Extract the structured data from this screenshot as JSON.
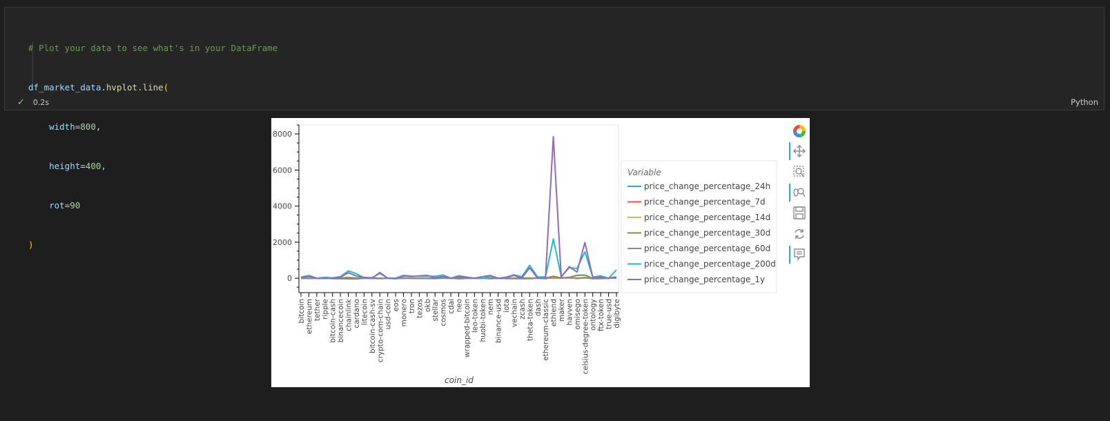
{
  "cell": {
    "code_lines": [
      {
        "type": "comment",
        "text": "# Plot your data to see what's in your DataFrame"
      },
      {
        "type": "call",
        "var": "df_market_data",
        "dot": ".",
        "fn": "hvplot.line",
        "open": "("
      },
      {
        "type": "arg",
        "name": "width",
        "eq": "=",
        "value": "800",
        "comma": ","
      },
      {
        "type": "arg",
        "name": "height",
        "eq": "=",
        "value": "400",
        "comma": ","
      },
      {
        "type": "arg",
        "name": "rot",
        "eq": "=",
        "value": "90",
        "comma": ""
      },
      {
        "type": "close",
        "text": ")"
      }
    ],
    "status_icon": "check-icon",
    "exec_time": "0.2s",
    "language": "Python"
  },
  "toolbar": {
    "tools": [
      "bokeh-logo-icon",
      "pan-icon",
      "box-zoom-icon",
      "wheel-zoom-icon",
      "save-icon",
      "reset-icon",
      "hover-icon"
    ]
  },
  "chart_data": {
    "type": "line",
    "xlabel": "coin_id",
    "ylabel": "",
    "ylim": [
      -800,
      8500
    ],
    "yticks": [
      0,
      2000,
      4000,
      6000,
      8000
    ],
    "legend_title": "Variable",
    "legend_position": "right",
    "categories": [
      "bitcoin",
      "ethereum",
      "tether",
      "ripple",
      "bitcoin-cash",
      "binancecoin",
      "chainlink",
      "cardano",
      "litecoin",
      "bitcoin-cash-sv",
      "crypto-com-chain",
      "usd-coin",
      "eos",
      "monero",
      "tron",
      "tezos",
      "okb",
      "stellar",
      "cosmos",
      "cdai",
      "neo",
      "wrapped-bitcoin",
      "leo-token",
      "huobi-token",
      "nem",
      "binance-usd",
      "iota",
      "vechain",
      "zcash",
      "theta-token",
      "dash",
      "ethereum-classic",
      "ethlend",
      "maker",
      "havven",
      "omisego",
      "celsius-degree-token",
      "ontology",
      "ftx-token",
      "true-usd",
      "digibyte"
    ],
    "series": [
      {
        "name": "price_change_percentage_24h",
        "color": "#30a2da",
        "values": [
          1,
          0,
          0,
          0,
          2,
          2,
          1,
          0,
          1,
          1,
          3,
          0,
          0,
          1,
          0,
          1,
          0,
          0,
          2,
          0,
          0,
          1,
          0,
          0,
          0,
          0,
          -1,
          1,
          1,
          1,
          0,
          0,
          1,
          0,
          2,
          1,
          2,
          1,
          1,
          0,
          1
        ]
      },
      {
        "name": "price_change_percentage_7d",
        "color": "#fc4f30",
        "values": [
          8,
          4,
          0,
          -4,
          20,
          15,
          6,
          8,
          13,
          16,
          -5,
          0,
          5,
          6,
          -1,
          0,
          -2,
          1,
          9,
          0,
          8,
          8,
          0,
          -4,
          1,
          0,
          -3,
          0,
          9,
          11,
          4,
          9,
          -2,
          5,
          4,
          15,
          8,
          0,
          -1,
          0,
          14
        ]
      },
      {
        "name": "price_change_percentage_14d",
        "color": "#e5ae38",
        "values": [
          7,
          12,
          0,
          -15,
          15,
          14,
          50,
          20,
          12,
          23,
          0,
          0,
          2,
          10,
          -6,
          0,
          -4,
          -7,
          5,
          0,
          9,
          7,
          0,
          -6,
          8,
          0,
          -8,
          -8,
          24,
          -6,
          12,
          13,
          23,
          15,
          6,
          25,
          11,
          -7,
          -10,
          0,
          17
        ]
      },
      {
        "name": "price_change_percentage_30d",
        "color": "#6d904f",
        "values": [
          -3,
          -14,
          0,
          -5,
          6,
          11,
          10,
          -3,
          20,
          26,
          -8,
          0,
          -10,
          -4,
          -7,
          -15,
          2,
          -7,
          -1,
          0,
          -3,
          -3,
          0,
          -1,
          -7,
          0,
          -10,
          -4,
          10,
          -17,
          18,
          12,
          107,
          20,
          50,
          160,
          176,
          -12,
          17,
          0,
          15
        ]
      },
      {
        "name": "price_change_percentage_60d",
        "color": "#8b8b8b",
        "values": [
          -8,
          -12,
          0,
          7,
          -22,
          -34,
          -40,
          -43,
          -6,
          -16,
          -22,
          0,
          -30,
          3,
          3,
          -8,
          -21,
          -25,
          6,
          0,
          -36,
          -11,
          0,
          4,
          -32,
          0,
          -26,
          -27,
          -31,
          -32,
          2,
          -30,
          69,
          -6,
          43,
          -20,
          43,
          -30,
          -26,
          0,
          20
        ]
      },
      {
        "name": "price_change_percentage_200d",
        "color": "#17becf",
        "values": [
          60,
          153,
          0,
          44,
          19,
          85,
          405,
          251,
          27,
          25,
          267,
          0,
          -0.3,
          158,
          120,
          105,
          112,
          107,
          180,
          0,
          138,
          65,
          0,
          -5,
          102,
          0,
          59,
          188,
          83,
          716,
          64,
          77,
          2174,
          90,
          579,
          542,
          1460,
          62,
          131,
          -4,
          462
        ]
      },
      {
        "name": "price_change_percentage_1y",
        "color": "#9467bd",
        "values": [
          37,
          101,
          0,
          -6,
          0,
          59,
          306,
          127,
          50,
          9,
          318,
          0,
          -29,
          117,
          87,
          128,
          159,
          21,
          94,
          -8,
          88,
          40,
          0,
          86,
          152,
          0,
          32,
          155,
          0,
          577,
          -3,
          16,
          7852,
          55,
          637,
          339,
          1984,
          44,
          48,
          0,
          71
        ]
      }
    ]
  }
}
